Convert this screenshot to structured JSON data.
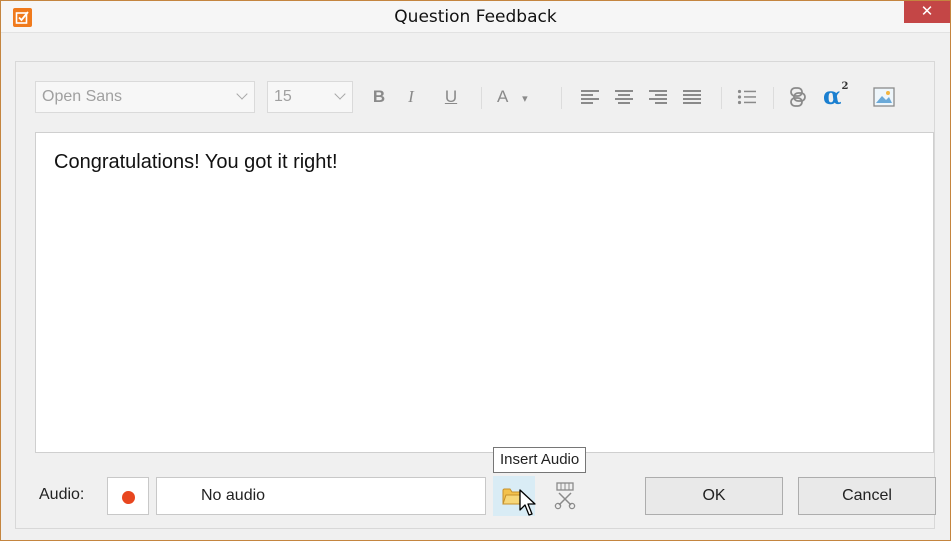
{
  "window": {
    "title": "Question Feedback",
    "close_glyph": "✕",
    "accent_color": "#f07a1c",
    "close_color": "#c44646"
  },
  "toolbar": {
    "font_family": "Open Sans",
    "font_size": "15",
    "bold": "B",
    "italic": "I",
    "underline": "U",
    "font_color": "A",
    "font_color_caret": "▾",
    "formula": "α",
    "formula_sup": "2",
    "icons": [
      "bold-icon",
      "italic-icon",
      "underline-icon",
      "font-color-icon",
      "align-left-icon",
      "align-center-icon",
      "align-right-icon",
      "align-justify-icon",
      "bulleted-list-icon",
      "hyperlink-icon",
      "formula-icon",
      "image-icon"
    ]
  },
  "editor": {
    "text": "Congratulations! You got it right!"
  },
  "audio": {
    "label": "Audio:",
    "value": "No audio",
    "tooltip": "Insert Audio",
    "record_color": "#e8461f"
  },
  "buttons": {
    "ok": "OK",
    "cancel": "Cancel"
  }
}
